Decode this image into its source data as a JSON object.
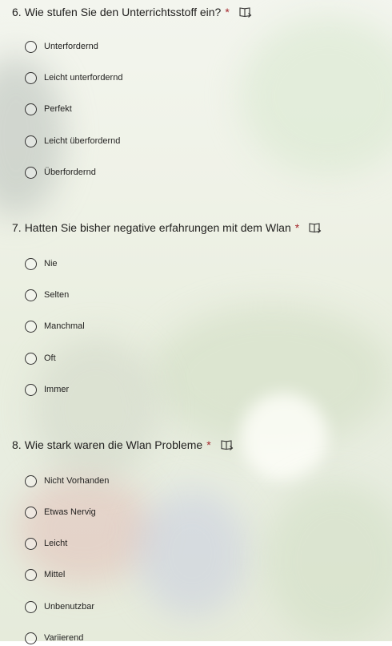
{
  "colors": {
    "required": "#a4262c",
    "text": "#201f1e",
    "radio_border": "#323130"
  },
  "icons": {
    "reader": "immersive-reader-icon"
  },
  "questions": [
    {
      "number": "6.",
      "text": "Wie stufen Sie den Unterrichtsstoff ein?",
      "required_mark": "*",
      "options": [
        "Unterfordernd",
        "Leicht unterfordernd",
        "Perfekt",
        "Leicht überfordernd",
        "Überfordernd"
      ]
    },
    {
      "number": "7.",
      "text": "Hatten Sie bisher negative erfahrungen mit dem Wlan",
      "required_mark": "*",
      "options": [
        "Nie",
        "Selten",
        "Manchmal",
        "Oft",
        "Immer"
      ]
    },
    {
      "number": "8.",
      "text": "Wie stark waren die Wlan Probleme",
      "required_mark": "*",
      "options": [
        "Nicht Vorhanden",
        "Etwas Nervig",
        "Leicht",
        "Mittel",
        "Unbenutzbar",
        "Variierend"
      ]
    }
  ]
}
